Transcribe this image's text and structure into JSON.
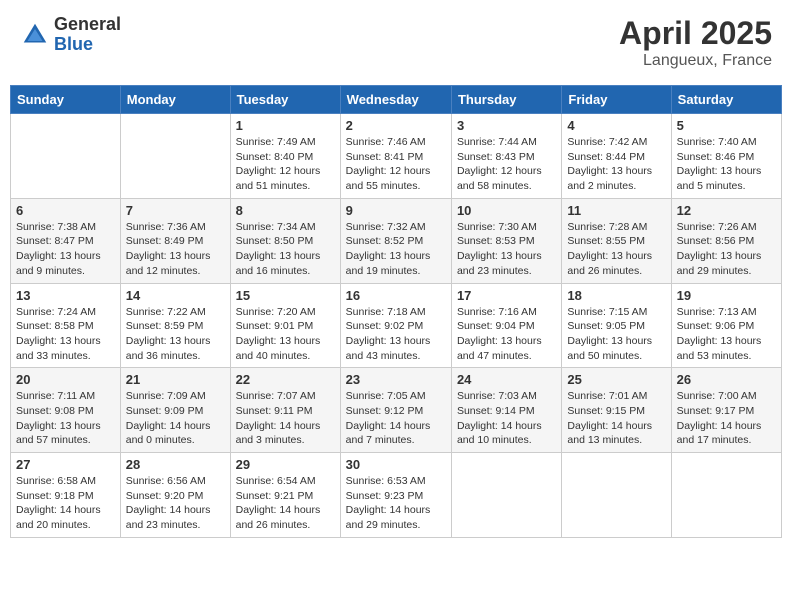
{
  "header": {
    "logo_general": "General",
    "logo_blue": "Blue",
    "month": "April 2025",
    "location": "Langueux, France"
  },
  "days_of_week": [
    "Sunday",
    "Monday",
    "Tuesday",
    "Wednesday",
    "Thursday",
    "Friday",
    "Saturday"
  ],
  "weeks": [
    [
      {
        "day": "",
        "info": ""
      },
      {
        "day": "",
        "info": ""
      },
      {
        "day": "1",
        "info": "Sunrise: 7:49 AM\nSunset: 8:40 PM\nDaylight: 12 hours and 51 minutes."
      },
      {
        "day": "2",
        "info": "Sunrise: 7:46 AM\nSunset: 8:41 PM\nDaylight: 12 hours and 55 minutes."
      },
      {
        "day": "3",
        "info": "Sunrise: 7:44 AM\nSunset: 8:43 PM\nDaylight: 12 hours and 58 minutes."
      },
      {
        "day": "4",
        "info": "Sunrise: 7:42 AM\nSunset: 8:44 PM\nDaylight: 13 hours and 2 minutes."
      },
      {
        "day": "5",
        "info": "Sunrise: 7:40 AM\nSunset: 8:46 PM\nDaylight: 13 hours and 5 minutes."
      }
    ],
    [
      {
        "day": "6",
        "info": "Sunrise: 7:38 AM\nSunset: 8:47 PM\nDaylight: 13 hours and 9 minutes."
      },
      {
        "day": "7",
        "info": "Sunrise: 7:36 AM\nSunset: 8:49 PM\nDaylight: 13 hours and 12 minutes."
      },
      {
        "day": "8",
        "info": "Sunrise: 7:34 AM\nSunset: 8:50 PM\nDaylight: 13 hours and 16 minutes."
      },
      {
        "day": "9",
        "info": "Sunrise: 7:32 AM\nSunset: 8:52 PM\nDaylight: 13 hours and 19 minutes."
      },
      {
        "day": "10",
        "info": "Sunrise: 7:30 AM\nSunset: 8:53 PM\nDaylight: 13 hours and 23 minutes."
      },
      {
        "day": "11",
        "info": "Sunrise: 7:28 AM\nSunset: 8:55 PM\nDaylight: 13 hours and 26 minutes."
      },
      {
        "day": "12",
        "info": "Sunrise: 7:26 AM\nSunset: 8:56 PM\nDaylight: 13 hours and 29 minutes."
      }
    ],
    [
      {
        "day": "13",
        "info": "Sunrise: 7:24 AM\nSunset: 8:58 PM\nDaylight: 13 hours and 33 minutes."
      },
      {
        "day": "14",
        "info": "Sunrise: 7:22 AM\nSunset: 8:59 PM\nDaylight: 13 hours and 36 minutes."
      },
      {
        "day": "15",
        "info": "Sunrise: 7:20 AM\nSunset: 9:01 PM\nDaylight: 13 hours and 40 minutes."
      },
      {
        "day": "16",
        "info": "Sunrise: 7:18 AM\nSunset: 9:02 PM\nDaylight: 13 hours and 43 minutes."
      },
      {
        "day": "17",
        "info": "Sunrise: 7:16 AM\nSunset: 9:04 PM\nDaylight: 13 hours and 47 minutes."
      },
      {
        "day": "18",
        "info": "Sunrise: 7:15 AM\nSunset: 9:05 PM\nDaylight: 13 hours and 50 minutes."
      },
      {
        "day": "19",
        "info": "Sunrise: 7:13 AM\nSunset: 9:06 PM\nDaylight: 13 hours and 53 minutes."
      }
    ],
    [
      {
        "day": "20",
        "info": "Sunrise: 7:11 AM\nSunset: 9:08 PM\nDaylight: 13 hours and 57 minutes."
      },
      {
        "day": "21",
        "info": "Sunrise: 7:09 AM\nSunset: 9:09 PM\nDaylight: 14 hours and 0 minutes."
      },
      {
        "day": "22",
        "info": "Sunrise: 7:07 AM\nSunset: 9:11 PM\nDaylight: 14 hours and 3 minutes."
      },
      {
        "day": "23",
        "info": "Sunrise: 7:05 AM\nSunset: 9:12 PM\nDaylight: 14 hours and 7 minutes."
      },
      {
        "day": "24",
        "info": "Sunrise: 7:03 AM\nSunset: 9:14 PM\nDaylight: 14 hours and 10 minutes."
      },
      {
        "day": "25",
        "info": "Sunrise: 7:01 AM\nSunset: 9:15 PM\nDaylight: 14 hours and 13 minutes."
      },
      {
        "day": "26",
        "info": "Sunrise: 7:00 AM\nSunset: 9:17 PM\nDaylight: 14 hours and 17 minutes."
      }
    ],
    [
      {
        "day": "27",
        "info": "Sunrise: 6:58 AM\nSunset: 9:18 PM\nDaylight: 14 hours and 20 minutes."
      },
      {
        "day": "28",
        "info": "Sunrise: 6:56 AM\nSunset: 9:20 PM\nDaylight: 14 hours and 23 minutes."
      },
      {
        "day": "29",
        "info": "Sunrise: 6:54 AM\nSunset: 9:21 PM\nDaylight: 14 hours and 26 minutes."
      },
      {
        "day": "30",
        "info": "Sunrise: 6:53 AM\nSunset: 9:23 PM\nDaylight: 14 hours and 29 minutes."
      },
      {
        "day": "",
        "info": ""
      },
      {
        "day": "",
        "info": ""
      },
      {
        "day": "",
        "info": ""
      }
    ]
  ]
}
